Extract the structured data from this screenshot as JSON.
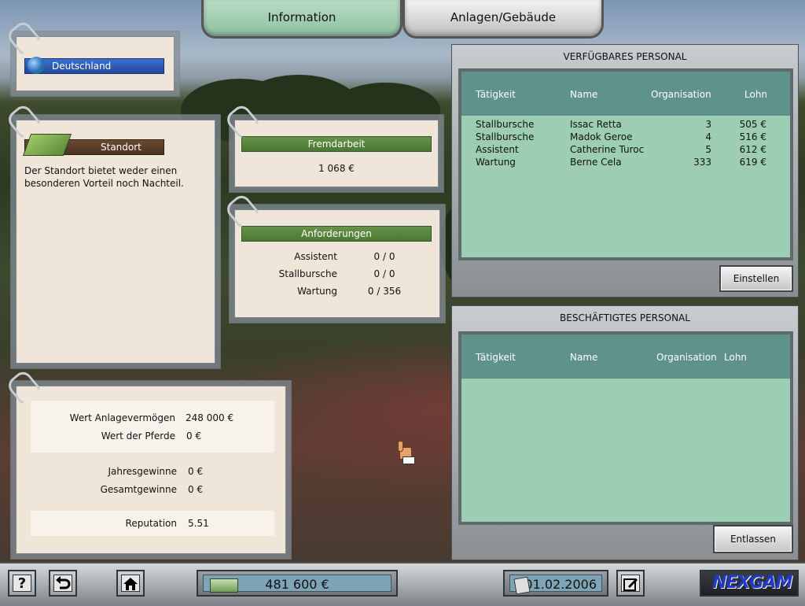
{
  "tabs": [
    {
      "label": "Information",
      "active": true
    },
    {
      "label": "Anlagen/Gebäude",
      "active": false
    }
  ],
  "country": {
    "label": "Deutschland",
    "icon": "globe-icon"
  },
  "standort": {
    "title": "Standort",
    "description": "Der Standort bietet weder einen besonderen Vorteil noch Nachteil.",
    "icon": "terrain-icon"
  },
  "fremdarbeit": {
    "title": "Fremdarbeit",
    "value": "1 068 €"
  },
  "anforderungen": {
    "title": "Anforderungen",
    "rows": [
      {
        "label": "Assistent",
        "value": "0 / 0"
      },
      {
        "label": "Stallbursche",
        "value": "0 / 0"
      },
      {
        "label": "Wartung",
        "value": "0 / 356"
      }
    ]
  },
  "finances": {
    "anlagevermoegen": {
      "label": "Wert Anlagevermögen",
      "value": "248 000 €"
    },
    "pferde": {
      "label": "Wert der Pferde",
      "value": "0 €"
    },
    "jahresgewinne": {
      "label": "Jahresgewinne",
      "value": "0 €"
    },
    "gesamtgewinne": {
      "label": "Gesamtgewinne",
      "value": "0 €"
    },
    "reputation": {
      "label": "Reputation",
      "value": "5.51"
    }
  },
  "available_staff": {
    "title": "VERFÜGBARES PERSONAL",
    "columns": [
      "Tätigkeit",
      "Name",
      "Organisation",
      "Lohn"
    ],
    "rows": [
      {
        "job": "Stallbursche",
        "name": "Issac Retta",
        "org": "3",
        "wage": "505 €"
      },
      {
        "job": "Stallbursche",
        "name": "Madok Geroe",
        "org": "4",
        "wage": "516 €"
      },
      {
        "job": "Assistent",
        "name": "Catherine Turoc",
        "org": "5",
        "wage": "612 €"
      },
      {
        "job": "Wartung",
        "name": "Berne Cela",
        "org": "333",
        "wage": "619 €"
      }
    ],
    "button": "Einstellen"
  },
  "employed_staff": {
    "title": "BESCHÄFTIGTES PERSONAL",
    "columns": [
      "Tätigkeit",
      "Name",
      "Organisation",
      "Lohn"
    ],
    "rows": [],
    "button": "Entlassen"
  },
  "bottom": {
    "help": "?",
    "money": "481 600 €",
    "date": "01.02.2006",
    "logo": "NEXGAM",
    "icons": [
      "help-icon",
      "undo-icon",
      "home-icon",
      "money-icon",
      "calendar-icon",
      "edit-icon"
    ]
  }
}
